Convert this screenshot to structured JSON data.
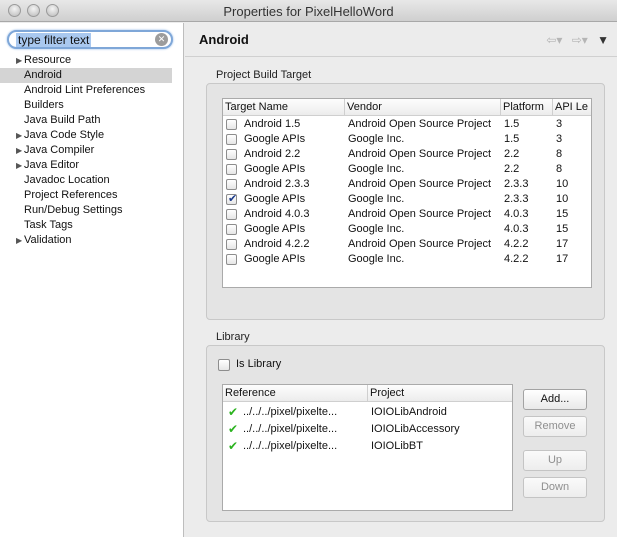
{
  "window": {
    "title": "Properties for PixelHelloWord"
  },
  "filter": {
    "text": "type filter text"
  },
  "tree": [
    {
      "label": "Resource",
      "expandable": true
    },
    {
      "label": "Android",
      "expandable": false,
      "selected": true
    },
    {
      "label": "Android Lint Preferences",
      "expandable": false
    },
    {
      "label": "Builders",
      "expandable": false
    },
    {
      "label": "Java Build Path",
      "expandable": false
    },
    {
      "label": "Java Code Style",
      "expandable": true
    },
    {
      "label": "Java Compiler",
      "expandable": true
    },
    {
      "label": "Java Editor",
      "expandable": true
    },
    {
      "label": "Javadoc Location",
      "expandable": false
    },
    {
      "label": "Project References",
      "expandable": false
    },
    {
      "label": "Run/Debug Settings",
      "expandable": false
    },
    {
      "label": "Task Tags",
      "expandable": false
    },
    {
      "label": "Validation",
      "expandable": true
    }
  ],
  "page": {
    "title": "Android",
    "icons": {
      "back": "back-arrow-icon",
      "forward": "forward-arrow-icon",
      "menu": "view-menu-icon"
    }
  },
  "build_target": {
    "label": "Project Build Target",
    "columns": [
      "Target Name",
      "Vendor",
      "Platform",
      "API Le"
    ],
    "rows": [
      {
        "name": "Android 1.5",
        "vendor": "Android Open Source Project",
        "platform": "1.5",
        "api": "3",
        "checked": false
      },
      {
        "name": "Google APIs",
        "vendor": "Google Inc.",
        "platform": "1.5",
        "api": "3",
        "checked": false
      },
      {
        "name": "Android 2.2",
        "vendor": "Android Open Source Project",
        "platform": "2.2",
        "api": "8",
        "checked": false
      },
      {
        "name": "Google APIs",
        "vendor": "Google Inc.",
        "platform": "2.2",
        "api": "8",
        "checked": false
      },
      {
        "name": "Android 2.3.3",
        "vendor": "Android Open Source Project",
        "platform": "2.3.3",
        "api": "10",
        "checked": false
      },
      {
        "name": "Google APIs",
        "vendor": "Google Inc.",
        "platform": "2.3.3",
        "api": "10",
        "checked": true
      },
      {
        "name": "Android 4.0.3",
        "vendor": "Android Open Source Project",
        "platform": "4.0.3",
        "api": "15",
        "checked": false
      },
      {
        "name": "Google APIs",
        "vendor": "Google Inc.",
        "platform": "4.0.3",
        "api": "15",
        "checked": false
      },
      {
        "name": "Android 4.2.2",
        "vendor": "Android Open Source Project",
        "platform": "4.2.2",
        "api": "17",
        "checked": false
      },
      {
        "name": "Google APIs",
        "vendor": "Google Inc.",
        "platform": "4.2.2",
        "api": "17",
        "checked": false
      }
    ]
  },
  "library": {
    "label": "Library",
    "is_library_label": "Is Library",
    "is_library_checked": false,
    "columns": [
      "Reference",
      "Project"
    ],
    "rows": [
      {
        "reference": "../../../pixel/pixelte...",
        "project": "IOIOLibAndroid"
      },
      {
        "reference": "../../../pixel/pixelte...",
        "project": "IOIOLibAccessory"
      },
      {
        "reference": "../../../pixel/pixelte...",
        "project": "IOIOLibBT"
      }
    ],
    "buttons": {
      "add": "Add...",
      "remove": "Remove",
      "up": "Up",
      "down": "Down"
    }
  }
}
